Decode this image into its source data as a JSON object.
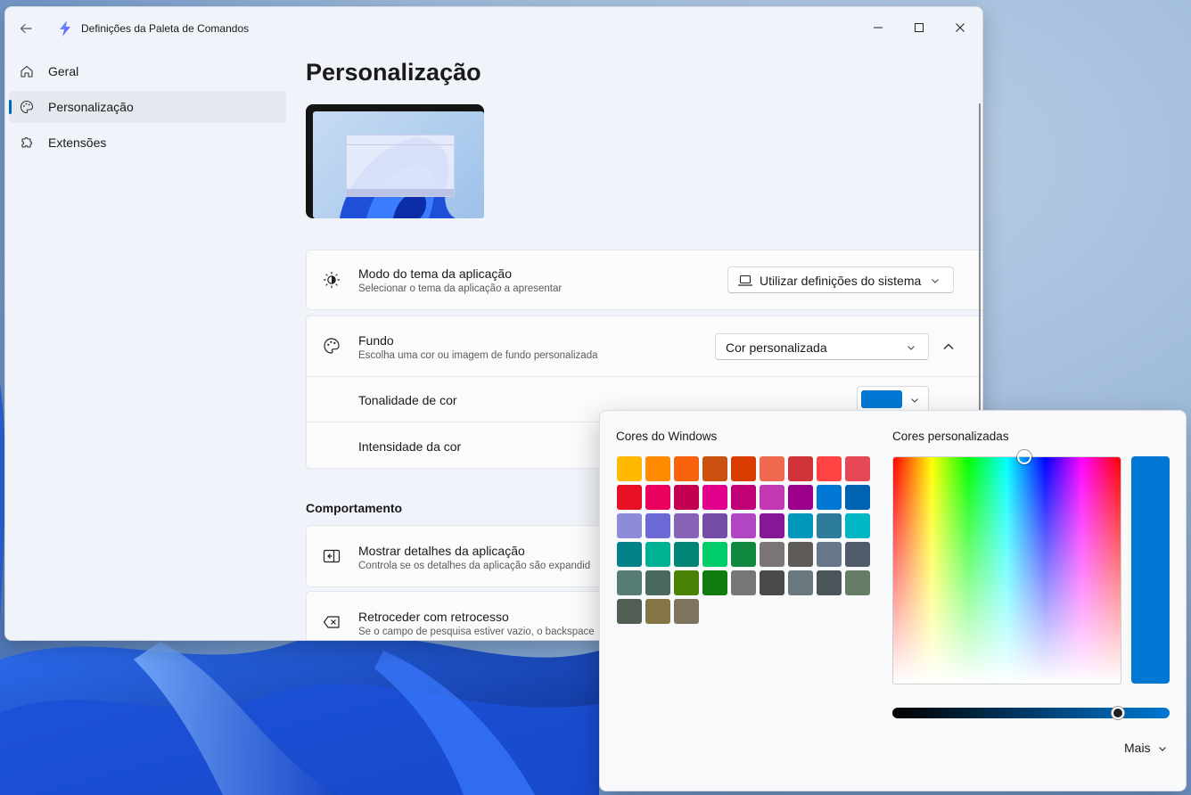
{
  "window": {
    "title": "Definições da Paleta de Comandos"
  },
  "sidebar": {
    "items": [
      {
        "label": "Geral",
        "icon": "home-icon"
      },
      {
        "label": "Personalização",
        "icon": "palette-icon",
        "selected": true
      },
      {
        "label": "Extensões",
        "icon": "puzzle-icon"
      }
    ]
  },
  "page": {
    "title": "Personalização"
  },
  "theme_card": {
    "title": "Modo do tema da aplicação",
    "subtitle": "Selecionar o tema da aplicação a apresentar",
    "value": "Utilizar definições do sistema"
  },
  "background_card": {
    "title": "Fundo",
    "subtitle": "Escolha uma cor ou imagem de fundo personalizada",
    "value": "Cor personalizada",
    "tint_label": "Tonalidade de cor",
    "intensity_label": "Intensidade da cor",
    "tint_color": "#0078d4"
  },
  "behavior": {
    "section_title": "Comportamento",
    "show_details": {
      "title": "Mostrar detalhes da aplicação",
      "subtitle": "Controla se os detalhes da aplicação são expandid"
    },
    "backspace": {
      "title": "Retroceder com retrocesso",
      "subtitle": "Se o campo de pesquisa estiver vazio, o backspace"
    }
  },
  "color_flyout": {
    "windows_colors_label": "Cores do Windows",
    "custom_colors_label": "Cores personalizadas",
    "more_label": "Mais",
    "selected_color": "#0078d4",
    "swatches": [
      "#ffb900",
      "#ff8c00",
      "#f7630c",
      "#ca5010",
      "#da3b01",
      "#ef6950",
      "#d13438",
      "#ff4343",
      "#e74856",
      "#e81123",
      "#ea005e",
      "#c30052",
      "#e3008c",
      "#bf0077",
      "#c239b3",
      "#9a0089",
      "#0078d4",
      "#0063b1",
      "#8e8cd8",
      "#6b69d6",
      "#8764b8",
      "#744da9",
      "#b146c2",
      "#881798",
      "#0099bc",
      "#2d7d9a",
      "#00b7c3",
      "#038387",
      "#00b294",
      "#018574",
      "#00cc6a",
      "#10893e",
      "#7a7574",
      "#5d5a58",
      "#68768a",
      "#515c6b",
      "#567c73",
      "#486860",
      "#498205",
      "#107c10",
      "#767676",
      "#4c4a48",
      "#69797e",
      "#4a5459",
      "#647c64",
      "#525e54",
      "#847545",
      "#7e735f"
    ]
  }
}
